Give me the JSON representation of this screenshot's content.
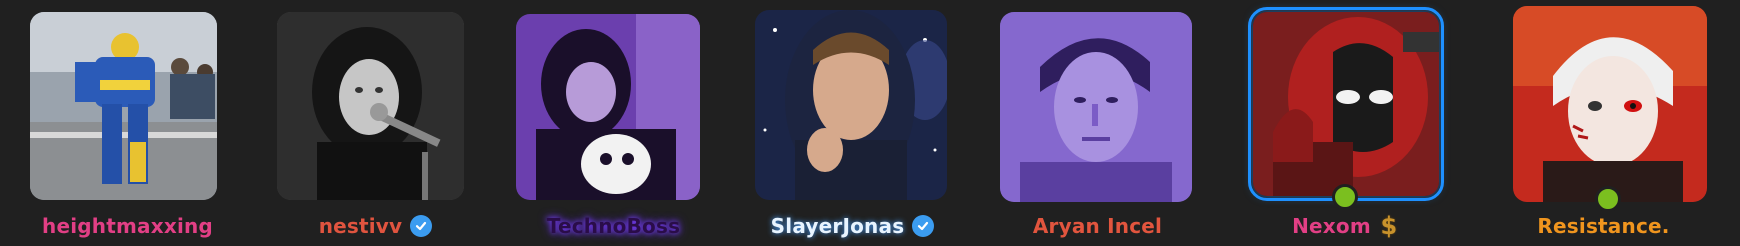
{
  "members": [
    {
      "name": "heightmaxxing",
      "name_color": "#e23f85",
      "verified": false,
      "online": false,
      "selected": false
    },
    {
      "name": "nestivv",
      "name_color": "#e0543f",
      "verified": true,
      "online": false,
      "selected": false
    },
    {
      "name": "TechnoBoss",
      "name_color": "#2a0d49",
      "verified": false,
      "online": false,
      "selected": false
    },
    {
      "name": "SlayerJonas",
      "name_color": "#e8f4ff",
      "verified": true,
      "online": false,
      "selected": false
    },
    {
      "name": "Aryan Incel",
      "name_color": "#e2553e",
      "verified": false,
      "online": false,
      "selected": false
    },
    {
      "name": "Nexom",
      "name_color": "#e23f85",
      "verified": false,
      "online": true,
      "selected": true,
      "badge": "dollar-icon"
    },
    {
      "name": "Resistance.",
      "name_color": "#f0951e",
      "verified": false,
      "online": true,
      "selected": false
    }
  ],
  "colors": {
    "background": "#202020",
    "online": "#7bbf1f",
    "selected_outline": "#1e90ff",
    "verified": "#3b9cf0"
  }
}
